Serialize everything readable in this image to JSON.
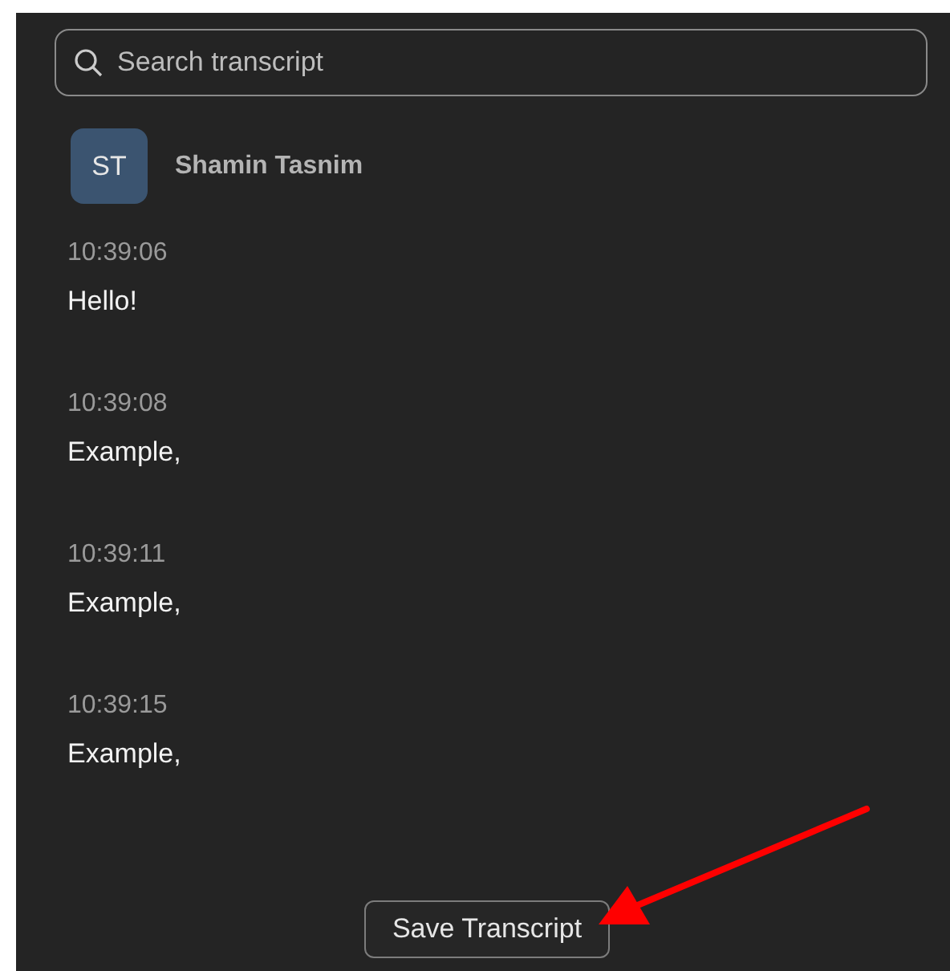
{
  "search": {
    "placeholder": "Search transcript"
  },
  "speaker": {
    "initials": "ST",
    "name": "Shamin Tasnim"
  },
  "entries": [
    {
      "time": "10:39:06",
      "text": "Hello!"
    },
    {
      "time": "10:39:08",
      "text": "Example,"
    },
    {
      "time": "10:39:11",
      "text": "Example,"
    },
    {
      "time": "10:39:15",
      "text": "Example,"
    }
  ],
  "buttons": [
    "Save Transcript"
  ]
}
